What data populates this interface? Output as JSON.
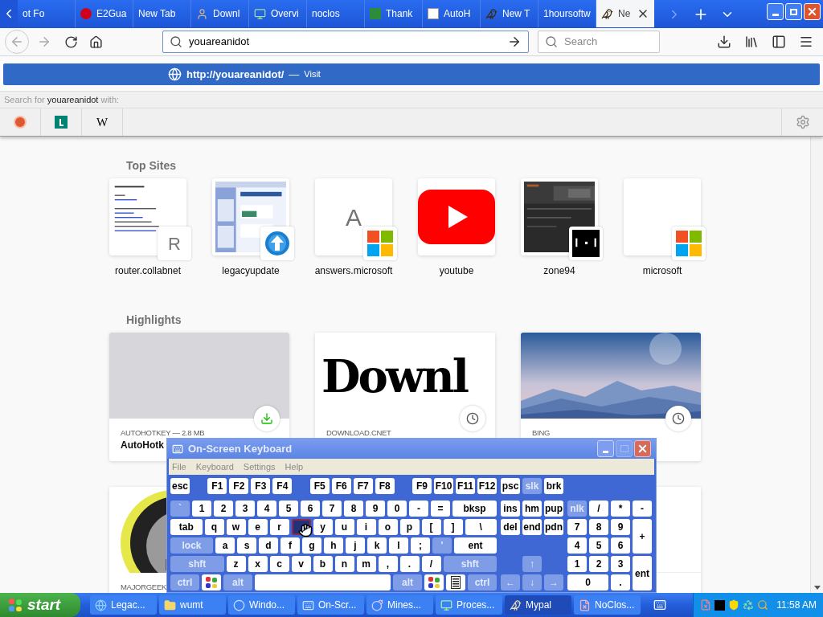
{
  "browser_tabs": [
    {
      "title": "ot Fo",
      "icon": false,
      "selected": false
    },
    {
      "title": "E2Gua",
      "icon": true,
      "selected": false
    },
    {
      "title": "New Tab",
      "icon": false,
      "selected": false
    },
    {
      "title": "Downl",
      "icon": true,
      "selected": false
    },
    {
      "title": "Overvi",
      "icon": true,
      "selected": false
    },
    {
      "title": "noclos",
      "icon": false,
      "selected": false
    },
    {
      "title": "Thank",
      "icon": true,
      "selected": false
    },
    {
      "title": "AutoH",
      "icon": true,
      "selected": false
    },
    {
      "title": "New T",
      "icon": true,
      "selected": false
    },
    {
      "title": "1hoursoftw",
      "icon": false,
      "selected": false
    },
    {
      "title": "Ne",
      "icon": true,
      "selected": true
    }
  ],
  "address_bar": {
    "value": "youareanidot"
  },
  "search_bar": {
    "placeholder": "Search"
  },
  "url_popup": {
    "suggestion": {
      "url": "http://youareanidot/",
      "separator": "—",
      "action": "Visit",
      "selected": true
    },
    "search_with": "Search for **youareanidot** with:",
    "engines": [
      {
        "kind": "duck"
      },
      {
        "kind": "bing"
      },
      {
        "kind": "letter",
        "label": "W"
      }
    ]
  },
  "top_sites": {
    "title": "Top Sites",
    "sites": [
      {
        "label": "router.collabnet",
        "badge": {
          "kind": "letter",
          "letter": "R"
        }
      },
      {
        "label": "legacyupdate",
        "badge": {
          "kind": "update"
        }
      },
      {
        "label": "answers.microsoft",
        "preview": {
          "kind": "letter",
          "letter": "A"
        },
        "badge": {
          "kind": "windows"
        }
      },
      {
        "label": "youtube",
        "preview": {
          "kind": "play"
        }
      },
      {
        "label": "zone94",
        "badge": {
          "kind": "pong"
        }
      },
      {
        "label": "microsoft",
        "preview": {
          "kind": "blank"
        },
        "badge": {
          "kind": "windows"
        }
      }
    ]
  },
  "highlights": {
    "title": "Highlights",
    "rows": [
      [
        {
          "context": "AUTOHOTKEY — 2.8 MB",
          "title": "AutoHotk",
          "preview": {
            "kind": "grey"
          },
          "badge": {
            "kind": "download"
          }
        },
        {
          "context": "DOWNLOAD.CNET",
          "preview": {
            "kind": "text",
            "text": "Downl"
          },
          "badge": {
            "kind": "history"
          }
        },
        {
          "context": "BING",
          "badge": {
            "kind": "history"
          }
        }
      ],
      [
        {
          "context": "MAJORGEEK"
        },
        {
          "preview": {
            "kind": "blank"
          }
        }
      ]
    ]
  },
  "keyboard": {
    "title": "On-Screen Keyboard",
    "menu": [
      "File",
      "Keyboard",
      "Settings",
      "Help"
    ],
    "function_groups": [
      [
        {
          "label": "esc",
          "kind": "key"
        }
      ],
      [
        {
          "label": "F1",
          "kind": "key"
        },
        {
          "label": "F2",
          "kind": "key"
        },
        {
          "label": "F3",
          "kind": "key"
        },
        {
          "label": "F4",
          "kind": "key"
        }
      ],
      [
        {
          "label": "F5",
          "kind": "key"
        },
        {
          "label": "F6",
          "kind": "key"
        },
        {
          "label": "F7",
          "kind": "key"
        },
        {
          "label": "F8",
          "kind": "key"
        }
      ],
      [
        {
          "label": "F9",
          "kind": "key"
        },
        {
          "label": "F10",
          "kind": "key"
        },
        {
          "label": "F11",
          "kind": "key"
        },
        {
          "label": "F12",
          "kind": "key"
        }
      ]
    ],
    "nav_function": [
      {
        "label": "psc",
        "kind": "key"
      },
      {
        "label": "slk",
        "kind": "dim-key"
      },
      {
        "label": "brk",
        "kind": "key"
      }
    ],
    "main_rows": [
      [
        {
          "label": "`",
          "kind": "dim-key"
        },
        {
          "label": "1",
          "kind": "key"
        },
        {
          "label": "2",
          "kind": "key"
        },
        {
          "label": "3",
          "kind": "key"
        },
        {
          "label": "4",
          "kind": "key"
        },
        {
          "label": "5",
          "kind": "key"
        },
        {
          "label": "6",
          "kind": "key"
        },
        {
          "label": "7",
          "kind": "key"
        },
        {
          "label": "8",
          "kind": "key"
        },
        {
          "label": "9",
          "kind": "key"
        },
        {
          "label": "0",
          "kind": "key"
        },
        {
          "label": "-",
          "kind": "key"
        },
        {
          "label": "=",
          "kind": "key"
        },
        {
          "label": "bksp",
          "kind": "wide"
        }
      ],
      [
        {
          "label": "tab",
          "kind": "wide"
        },
        {
          "label": "q",
          "kind": "key"
        },
        {
          "label": "w",
          "kind": "key"
        },
        {
          "label": "e",
          "kind": "key"
        },
        {
          "label": "r",
          "kind": "key"
        },
        {
          "kind": "pressed"
        },
        {
          "label": "y",
          "kind": "key"
        },
        {
          "label": "u",
          "kind": "key"
        },
        {
          "label": "i",
          "kind": "key"
        },
        {
          "label": "o",
          "kind": "key"
        },
        {
          "label": "p",
          "kind": "key"
        },
        {
          "label": "[",
          "kind": "key"
        },
        {
          "label": "]",
          "kind": "key"
        },
        {
          "label": "\\",
          "kind": "wide"
        }
      ],
      [
        {
          "label": "lock",
          "kind": "dim-wide"
        },
        {
          "label": "a",
          "kind": "key"
        },
        {
          "label": "s",
          "kind": "key"
        },
        {
          "label": "d",
          "kind": "key"
        },
        {
          "label": "f",
          "kind": "key"
        },
        {
          "label": "g",
          "kind": "key"
        },
        {
          "label": "h",
          "kind": "key"
        },
        {
          "label": "j",
          "kind": "key"
        },
        {
          "label": "k",
          "kind": "key"
        },
        {
          "label": "l",
          "kind": "key"
        },
        {
          "label": ";",
          "kind": "key"
        },
        {
          "label": "'",
          "kind": "dim-key"
        },
        {
          "label": "ent",
          "kind": "wide"
        }
      ],
      [
        {
          "label": "shft",
          "kind": "dim-wide"
        },
        {
          "label": "z",
          "kind": "key"
        },
        {
          "label": "x",
          "kind": "key"
        },
        {
          "label": "c",
          "kind": "key"
        },
        {
          "label": "v",
          "kind": "key"
        },
        {
          "label": "b",
          "kind": "key"
        },
        {
          "label": "n",
          "kind": "key"
        },
        {
          "label": "m",
          "kind": "key"
        },
        {
          "label": ",",
          "kind": "key"
        },
        {
          "label": ".",
          "kind": "key"
        },
        {
          "label": "/",
          "kind": "key"
        },
        {
          "label": "shft",
          "kind": "dim-wide"
        }
      ],
      [
        {
          "label": "ctrl",
          "kind": "dim-mod"
        },
        {
          "kind": "logo"
        },
        {
          "label": "alt",
          "kind": "dim-mod"
        },
        {
          "kind": "space"
        },
        {
          "label": "alt",
          "kind": "dim-mod"
        },
        {
          "kind": "logo"
        },
        {
          "kind": "menu"
        },
        {
          "label": "ctrl",
          "kind": "dim-mod"
        }
      ]
    ],
    "nav_upper": [
      [
        {
          "label": "ins",
          "kind": "key"
        },
        {
          "label": "hm",
          "kind": "key"
        },
        {
          "label": "pup",
          "kind": "key"
        }
      ],
      [
        {
          "label": "del",
          "kind": "key"
        },
        {
          "label": "end",
          "kind": "key"
        },
        {
          "label": "pdn",
          "kind": "key"
        }
      ]
    ],
    "nav_lower": [
      [
        {
          "label": "↑",
          "kind": "dim-key"
        }
      ],
      [
        {
          "label": "←",
          "kind": "dim-key"
        },
        {
          "label": "↓",
          "kind": "dim-key"
        },
        {
          "label": "→",
          "kind": "dim-key"
        }
      ]
    ],
    "numpad": [
      {
        "label": "nlk",
        "kind": "dim-key"
      },
      {
        "label": "/",
        "kind": "key"
      },
      {
        "label": "*",
        "kind": "key"
      },
      {
        "label": "-",
        "kind": "key"
      },
      {
        "label": "7",
        "kind": "key"
      },
      {
        "label": "8",
        "kind": "key"
      },
      {
        "label": "9",
        "kind": "key"
      },
      {
        "label": "+",
        "kind": "tall"
      },
      {
        "label": "4",
        "kind": "key"
      },
      {
        "label": "5",
        "kind": "key"
      },
      {
        "label": "6",
        "kind": "key"
      },
      {
        "label": "1",
        "kind": "key"
      },
      {
        "label": "2",
        "kind": "key"
      },
      {
        "label": "3",
        "kind": "key"
      },
      {
        "label": "ent",
        "kind": "tall"
      },
      {
        "label": "0",
        "kind": "double"
      },
      {
        "label": ".",
        "kind": "key"
      }
    ]
  },
  "taskbar": {
    "start": "start",
    "items": [
      {
        "label": "Legac...",
        "selected": false
      },
      {
        "label": "wumt",
        "selected": false
      },
      {
        "label": "Windo...",
        "selected": false
      },
      {
        "label": "On-Scr...",
        "selected": false
      },
      {
        "label": "Mines...",
        "selected": false
      },
      {
        "label": "Proces...",
        "selected": false
      },
      {
        "label": "Mypal",
        "selected": true
      },
      {
        "label": "NoClos...",
        "selected": false
      }
    ],
    "clock": "11:58 AM"
  }
}
